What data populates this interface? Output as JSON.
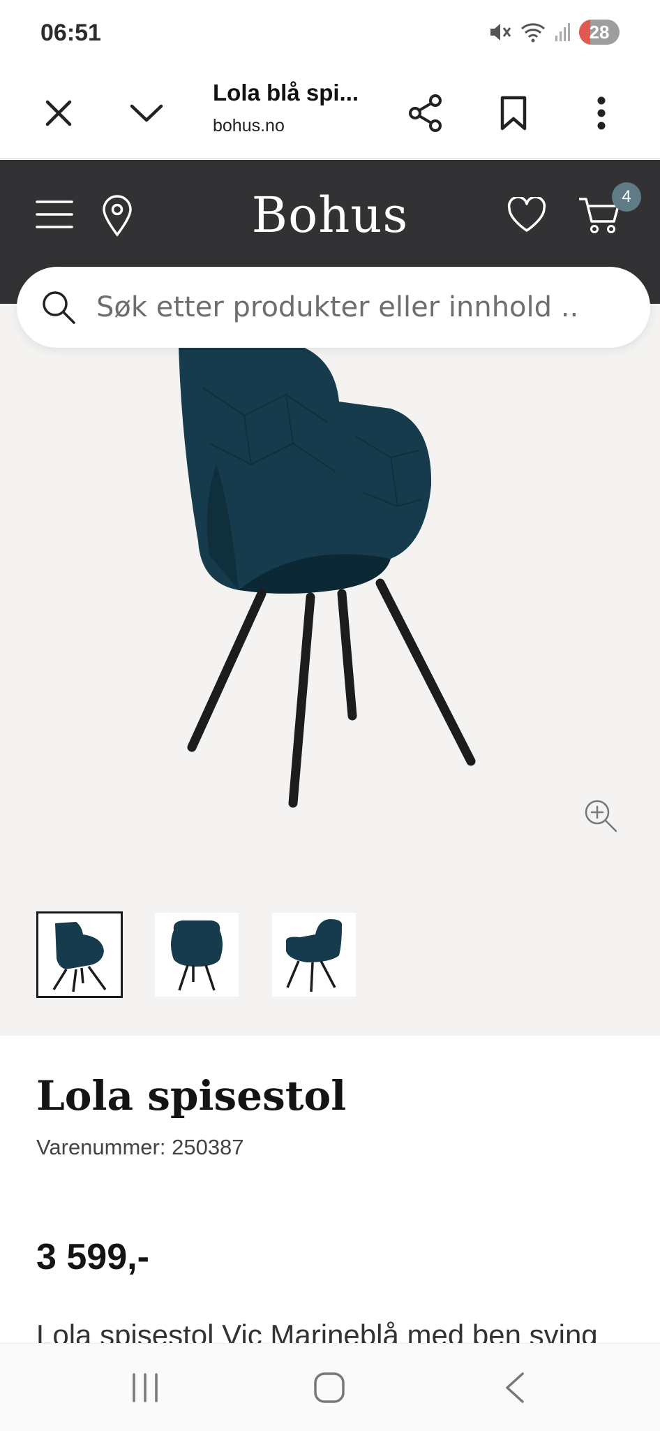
{
  "status_bar": {
    "time": "06:51",
    "battery": "28"
  },
  "browser": {
    "tab_title": "Lola blå spi...",
    "url": "bohus.no"
  },
  "site": {
    "logo": "Bohus",
    "cart_count": "4"
  },
  "search": {
    "placeholder": "Søk etter produkter eller innhold .."
  },
  "product": {
    "title": "Lola spisestol",
    "sku": "Varenummer: 250387",
    "price": "3 599,-",
    "description": "Lola spisestol Vic Marineblå med ben sving"
  },
  "colors": {
    "header_bg": "#323235",
    "gallery_bg": "#f4f3f1",
    "chair": "#163b4c",
    "badge": "#5f7b86"
  }
}
